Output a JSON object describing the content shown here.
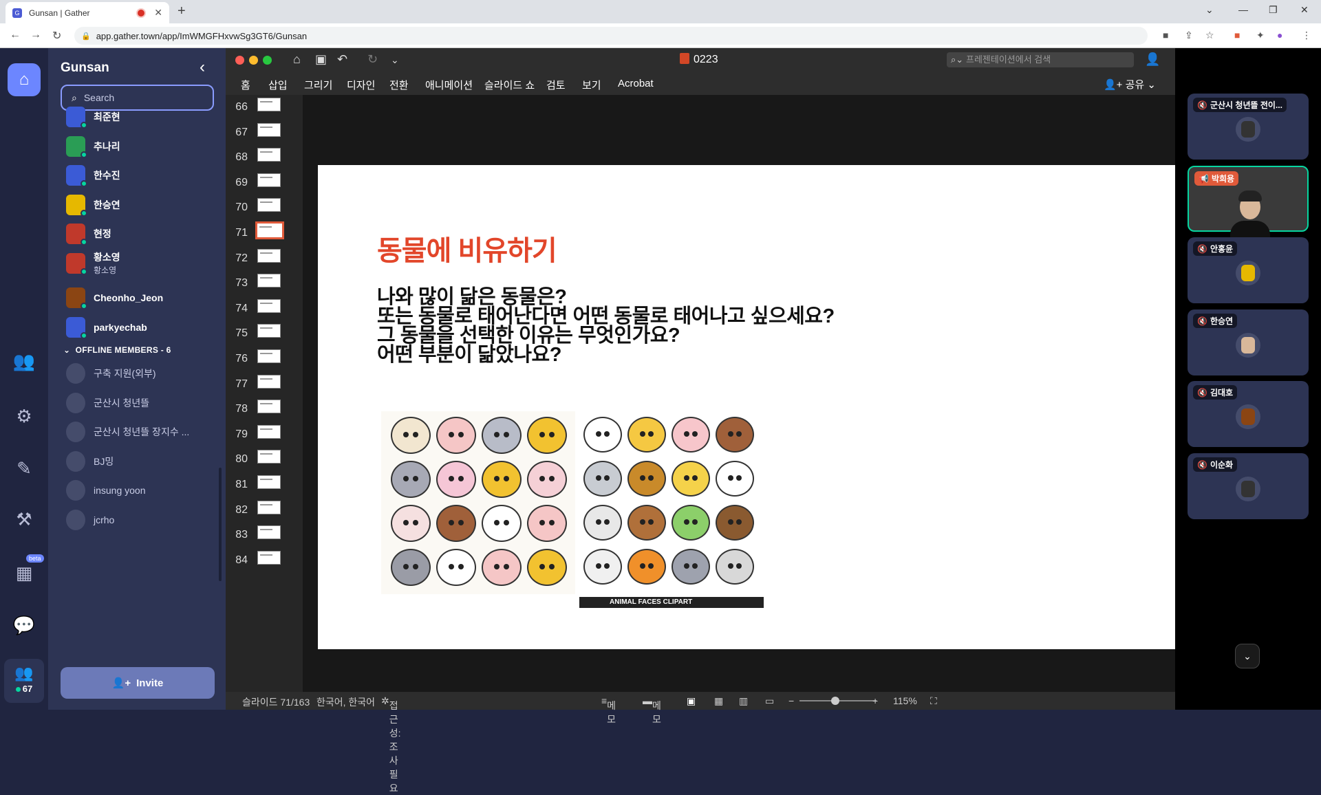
{
  "browser": {
    "tab_title": "Gunsan | Gather",
    "url": "app.gather.town/app/ImWMGFHxvwSg3GT6/Gunsan"
  },
  "sidebar": {
    "space_name": "Gunsan",
    "search_placeholder": "Search",
    "online_members": [
      {
        "name": "최준현",
        "sub": "",
        "color": "#3b5bd6"
      },
      {
        "name": "추나리",
        "sub": "",
        "color": "#2a9d55"
      },
      {
        "name": "한수진",
        "sub": "",
        "color": "#3b5bd6"
      },
      {
        "name": "한승연",
        "sub": "",
        "color": "#e6b800"
      },
      {
        "name": "현정",
        "sub": "",
        "color": "#c0392b"
      },
      {
        "name": "황소영",
        "sub": "황소영",
        "color": "#c0392b"
      },
      {
        "name": "Cheonho_Jeon",
        "sub": "",
        "color": "#8b4513"
      },
      {
        "name": "parkyechab",
        "sub": "",
        "color": "#3b5bd6"
      }
    ],
    "offline_header": "OFFLINE MEMBERS - 6",
    "offline_members": [
      {
        "name": "구축 지원(외부)"
      },
      {
        "name": "군산시 청년뜰"
      },
      {
        "name": "군산시 청년뜰 장지수 ..."
      },
      {
        "name": "BJ밍"
      },
      {
        "name": "insung yoon"
      },
      {
        "name": "jcrho"
      }
    ],
    "invite_label": "Invite",
    "beta_label": "beta",
    "people_count": "67"
  },
  "ppt": {
    "doc_title": "0223",
    "search_placeholder": "프레젠테이션에서 검색",
    "ribbon_tabs": [
      "홈",
      "삽입",
      "그리기",
      "디자인",
      "전환",
      "애니메이션",
      "슬라이드 쇼",
      "검토",
      "보기",
      "Acrobat"
    ],
    "share_label": "공유",
    "thumbnails": [
      "66",
      "67",
      "68",
      "69",
      "70",
      "71",
      "72",
      "73",
      "74",
      "75",
      "76",
      "77",
      "78",
      "79",
      "80",
      "81",
      "82",
      "83",
      "84"
    ],
    "selected_thumbnail": "71",
    "slide": {
      "title": "동물에 비유하기",
      "questions": [
        "나와 많이 닮은 동물은?",
        "또는 동물로 태어난다면 어떤 동물로 태어나고 싶으세요?",
        "그 동물을 선택한 이유는 무엇인가요?",
        "어떤 부분이 닮았나요?"
      ],
      "image_caption": "ANIMAL FACES CLIPART"
    },
    "status": {
      "slide_counter": "슬라이드 71/163",
      "language": "한국어, 한국어",
      "accessibility": "접근성: 조사 필요",
      "notes1": "메모",
      "notes2": "메모",
      "zoom": "115%"
    }
  },
  "video": {
    "tiles": [
      {
        "name": "군산시 청년뜰 전이...",
        "active": false
      },
      {
        "name": "박희용",
        "active": true
      },
      {
        "name": "안홍윤",
        "active": false
      },
      {
        "name": "한승연",
        "active": false
      },
      {
        "name": "김대호",
        "active": false
      },
      {
        "name": "이순화",
        "active": false
      }
    ]
  }
}
